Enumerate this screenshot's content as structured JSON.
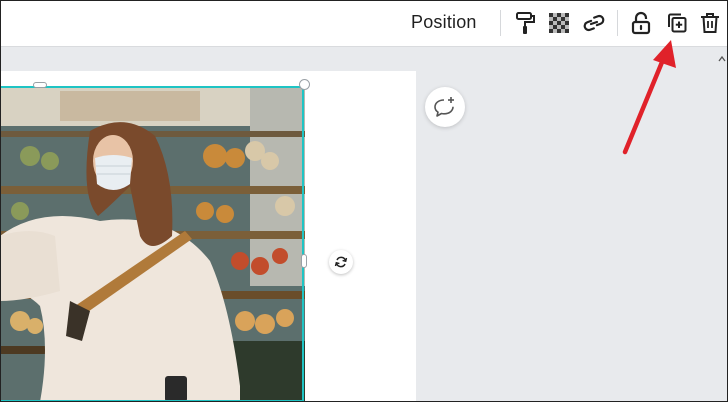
{
  "toolbar": {
    "position_label": "Position",
    "icons": [
      "paint-roller-icon",
      "transparency-icon",
      "link-icon",
      "unlock-icon",
      "duplicate-icon",
      "trash-icon"
    ]
  },
  "colors": {
    "selection_border": "#1fc4c4",
    "annotation_arrow": "#e0222a",
    "canvas_background": "#e8eaed"
  },
  "canvas": {
    "image_description_icon": "photo-icon"
  }
}
